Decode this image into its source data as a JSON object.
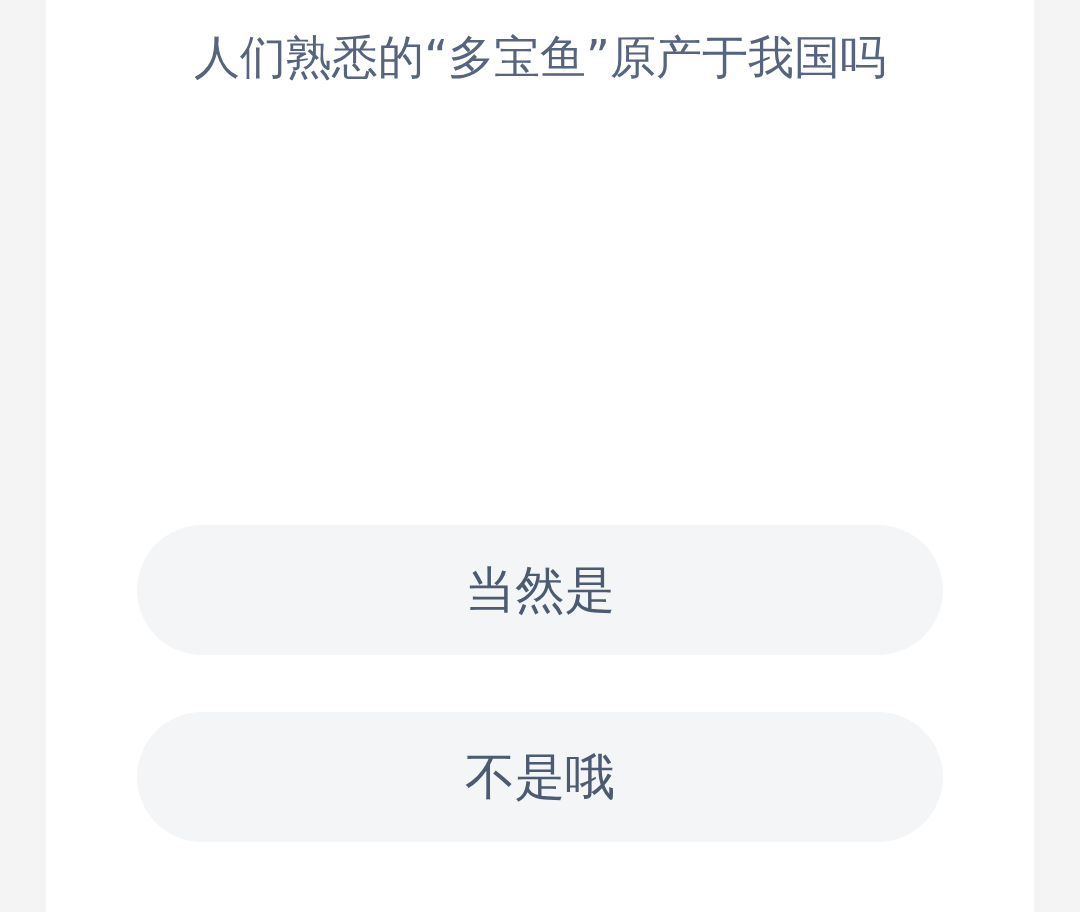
{
  "question": "人们熟悉的“多宝鱼”原产于我国吗",
  "options": [
    {
      "label": "当然是"
    },
    {
      "label": "不是哦"
    }
  ]
}
